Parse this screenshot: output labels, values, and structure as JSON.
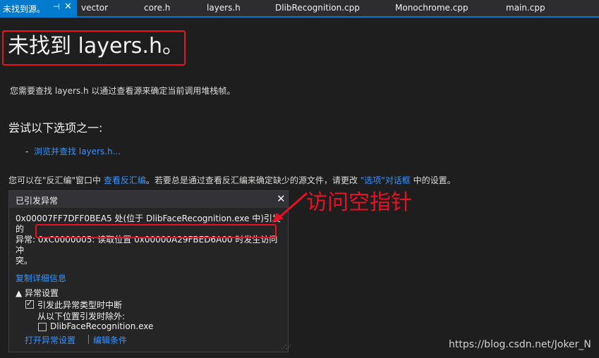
{
  "tabs": {
    "active": "未找到源。",
    "pin_glyph": "⊣",
    "close_glyph": "✕",
    "others": [
      "vector",
      "core.h",
      "layers.h",
      "DlibRecognition.cpp",
      "Monochrome.cpp",
      "main.cpp"
    ]
  },
  "page": {
    "title": "未找到 layers.h。",
    "subtitle": "您需要查找 layers.h 以通过查看源来确定当前调用堆栈帧。",
    "options_heading": "尝试以下选项之一:",
    "option_dash": "-",
    "option_browse": "浏览并查找 layers.h...",
    "info_prefix": "您可以在\"反汇编\"窗口中 ",
    "info_link_disasm": "查看反汇编",
    "info_middle": "。若要总是通过查看反汇编来确定缺少的源文件，请更改 ",
    "info_link_options": "\"选项\"对话框",
    "info_suffix": " 中的设置。"
  },
  "exception": {
    "title": "已引发异常",
    "close_glyph": "✕",
    "message_line1": "0x00007FF7DFF0BEA5 处(位于 DlibFaceRecognition.exe 中)引发的",
    "message_line2a": "异常: ",
    "message_line2b": "0xC0000005: 读取位置 0x00000A29FBED6A00 时发生访问冲",
    "message_line3": "突。",
    "copy_details": "复制详细信息",
    "settings_header": "▲ 异常设置",
    "break_on_type": "引发此异常类型时中断",
    "except_from": "从以下位置引发时除外:",
    "module": "DlibFaceRecognition.exe",
    "open_settings": "打开异常设置",
    "edit_conditions": "编辑条件",
    "break_checked": true,
    "module_checked": false
  },
  "annotation": {
    "text": "访问空指针",
    "color": "#e81123"
  },
  "watermark": "https://blog.csdn.net/Joker_N",
  "colors": {
    "accent": "#007acc",
    "link": "#3794ff",
    "background": "#1e1e1e"
  }
}
